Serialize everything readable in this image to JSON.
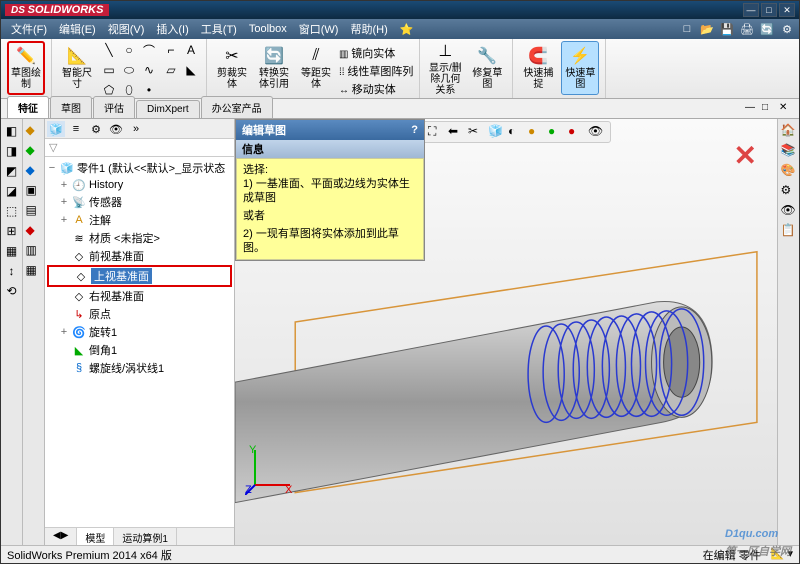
{
  "app": {
    "title": "SOLIDWORKS"
  },
  "menu": {
    "items": [
      "文件(F)",
      "编辑(E)",
      "视图(V)",
      "插入(I)",
      "工具(T)",
      "Toolbox",
      "窗口(W)",
      "帮助(H)"
    ]
  },
  "ribbon": {
    "sketch_btn": "草图绘制",
    "smart_dim": "智能尺寸",
    "trim": "剪裁实体",
    "convert": "转换实体引用",
    "offset": "等距实体",
    "mirror": "镜向实体",
    "pattern": "线性草图阵列",
    "move": "移动实体",
    "display": "显示/删除几何关系",
    "repair": "修复草图",
    "snap": "快速捕捉",
    "rapid": "快速草图"
  },
  "tabs": {
    "items": [
      "特征",
      "草图",
      "评估",
      "DimXpert",
      "办公室产品"
    ],
    "active": 0
  },
  "tree": {
    "filter_placeholder": "▽",
    "root": "零件1 (默认<<默认>_显示状态",
    "history": "History",
    "sensors": "传感器",
    "annot": "注解",
    "material": "材质 <未指定>",
    "front": "前视基准面",
    "top": "上视基准面",
    "right": "右视基准面",
    "origin": "原点",
    "rev": "旋转1",
    "cham": "倒角1",
    "helix": "螺旋线/涡状线1",
    "bottom_tabs": [
      "",
      "模型",
      "运动算例1"
    ]
  },
  "prop": {
    "title": "编辑草图",
    "info_header": "信息",
    "txt_select": "选择:",
    "txt_1": "1) 一基准面、平面或边线为实体生成草图",
    "txt_or": "或者",
    "txt_2": "2) 一现有草图将实体添加到此草图。"
  },
  "status": {
    "left": "SolidWorks Premium 2014 x64 版",
    "mode": "在编辑 零件"
  },
  "watermark": {
    "big": "D1qu.com",
    "small": "第一区自学网"
  }
}
